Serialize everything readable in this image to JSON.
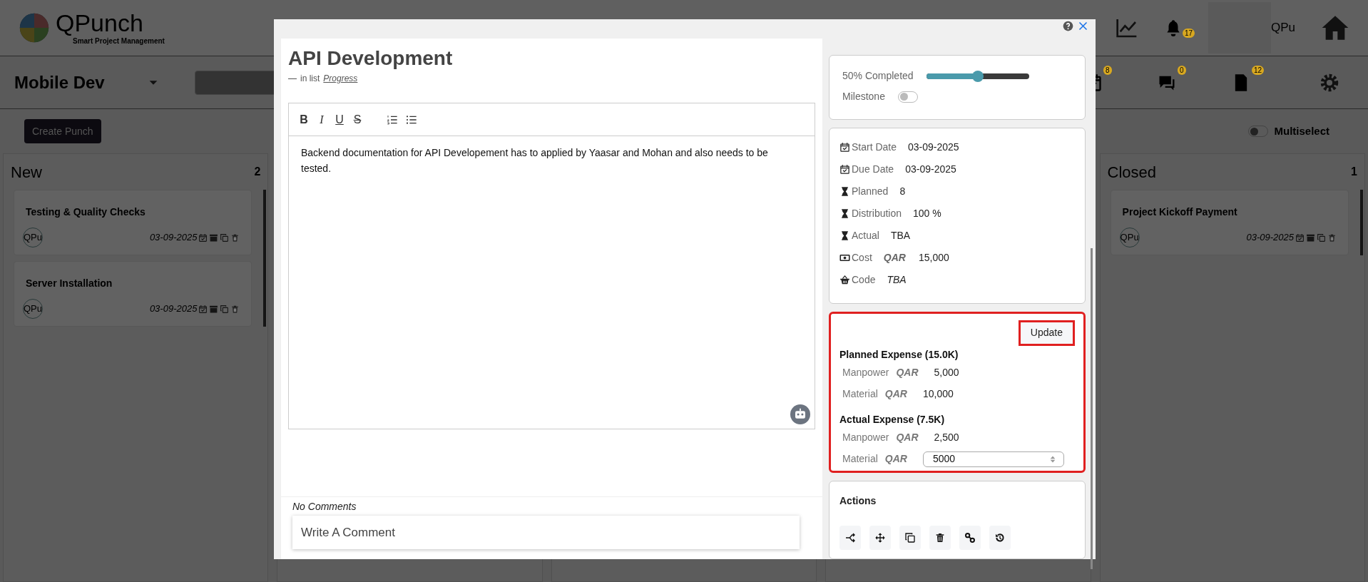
{
  "header": {
    "logo_title": "QPunch",
    "logo_subtitle": "Smart Project Management",
    "notification_count": "17",
    "avatar_text": "QPu"
  },
  "subheader": {
    "project": "Mobile Dev",
    "badges": [
      {
        "kind": "calendar",
        "count": "8"
      },
      {
        "kind": "chat",
        "count": "0"
      },
      {
        "kind": "document",
        "count": "12"
      }
    ]
  },
  "create_button": "Create Punch",
  "multiselect": {
    "label": "Multiselect",
    "on": false
  },
  "columns": [
    {
      "title": "New",
      "count": "2",
      "cards": [
        {
          "title": "Testing & Quality Checks",
          "avatar": "QPu",
          "date": "03-09-2025"
        },
        {
          "title": "Server Installation",
          "avatar": "QPu",
          "date": "03-09-2025"
        }
      ]
    },
    {
      "title": "Closed",
      "count": "1",
      "cards": [
        {
          "title": "Project Kickoff Payment",
          "avatar": "QPu",
          "date": "03-09-2025"
        }
      ]
    }
  ],
  "modal": {
    "title": "API Development",
    "list_prefix": "in list",
    "list_name": "Progress",
    "format_buttons": [
      "B",
      "I",
      "U",
      "S"
    ],
    "description": "Backend documentation for API Developement has to applied by Yaasar and Mohan and also needs to be tested.",
    "comments": {
      "empty_text": "No Comments",
      "placeholder": "Write A Comment"
    },
    "progress": {
      "label": "50% Completed",
      "level": 0.5
    },
    "milestone": {
      "label": "Milestone",
      "on": false
    },
    "details": [
      {
        "kind": "calendar",
        "label": "Start Date",
        "value": "03-09-2025"
      },
      {
        "kind": "calendar",
        "label": "Due Date",
        "value": "03-09-2025"
      },
      {
        "kind": "hourglass",
        "label": "Planned",
        "value": "8"
      },
      {
        "kind": "hourglass",
        "label": "Distribution",
        "value": "100 %"
      },
      {
        "kind": "hourglass",
        "label": "Actual",
        "value": "TBA"
      },
      {
        "kind": "money",
        "label": "Cost",
        "currency": "QAR",
        "value": "15,000"
      },
      {
        "kind": "basket",
        "label": "Code",
        "value": "TBA",
        "italic": true
      }
    ],
    "expenses": {
      "update_label": "Update",
      "groups": [
        {
          "title": "Planned Expense (15.0K)",
          "items": [
            {
              "kind": "text",
              "label": "Manpower",
              "currency": "QAR",
              "value": "5,000"
            },
            {
              "kind": "text",
              "label": "Material",
              "currency": "QAR",
              "value": "10,000"
            }
          ]
        },
        {
          "title": "Actual Expense (7.5K)",
          "items": [
            {
              "kind": "text",
              "label": "Manpower",
              "currency": "QAR",
              "value": "2,500"
            },
            {
              "kind": "input",
              "label": "Material",
              "currency": "QAR",
              "value": "5000"
            }
          ]
        }
      ]
    },
    "actions": {
      "title": "Actions",
      "buttons": [
        {
          "kind": "branch"
        },
        {
          "kind": "move"
        },
        {
          "kind": "copy"
        },
        {
          "kind": "delete"
        },
        {
          "kind": "link"
        },
        {
          "kind": "history"
        }
      ]
    }
  }
}
